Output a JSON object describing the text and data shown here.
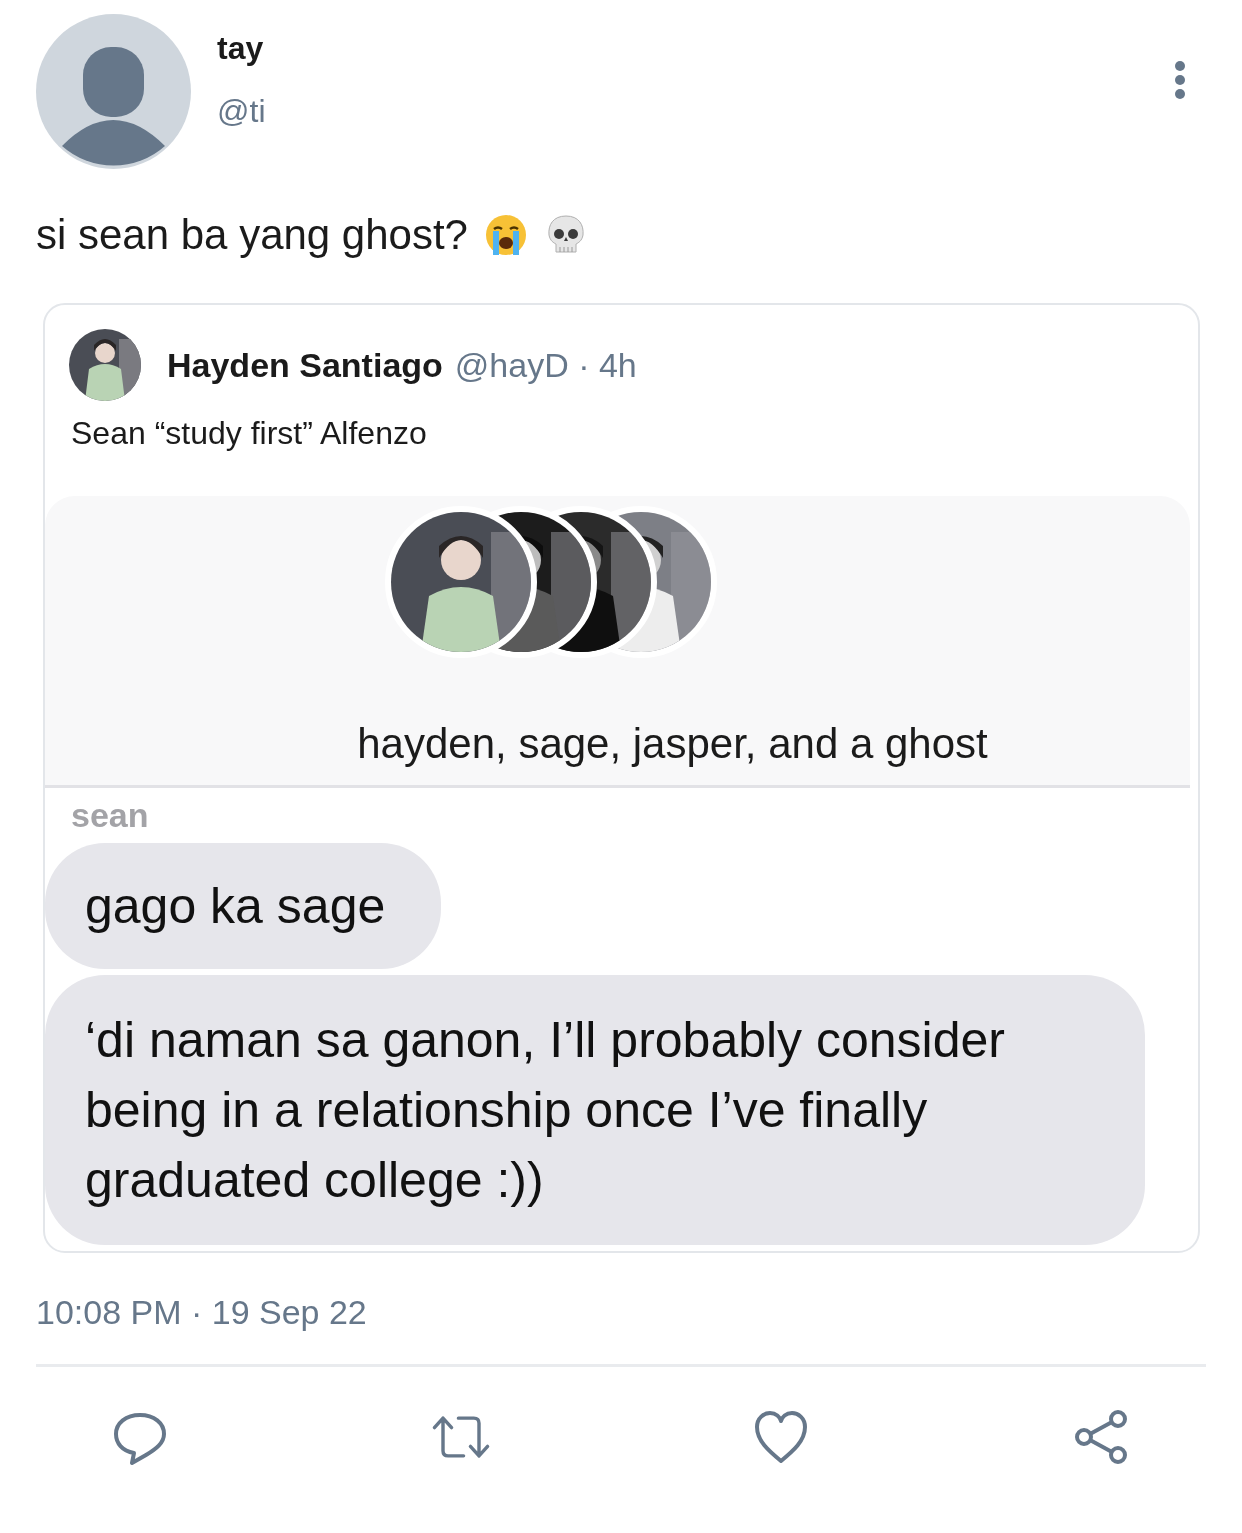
{
  "author": {
    "name": "tay",
    "handle": "@ti"
  },
  "text": "si sean ba yang ghost?",
  "quote": {
    "name": "Hayden Santiago",
    "handle": "@hayD · 4h",
    "text": "Sean “study first” Alfenzo",
    "media": {
      "title": "hayden, sage, jasper, and a ghost",
      "sender": "sean",
      "messages": [
        "gago ka sage",
        "‘di naman sa ganon, I’ll probably consider being in a relationship once I’ve finally graduated college :))"
      ]
    }
  },
  "timestamp": "10:08 PM · 19 Sep 22"
}
